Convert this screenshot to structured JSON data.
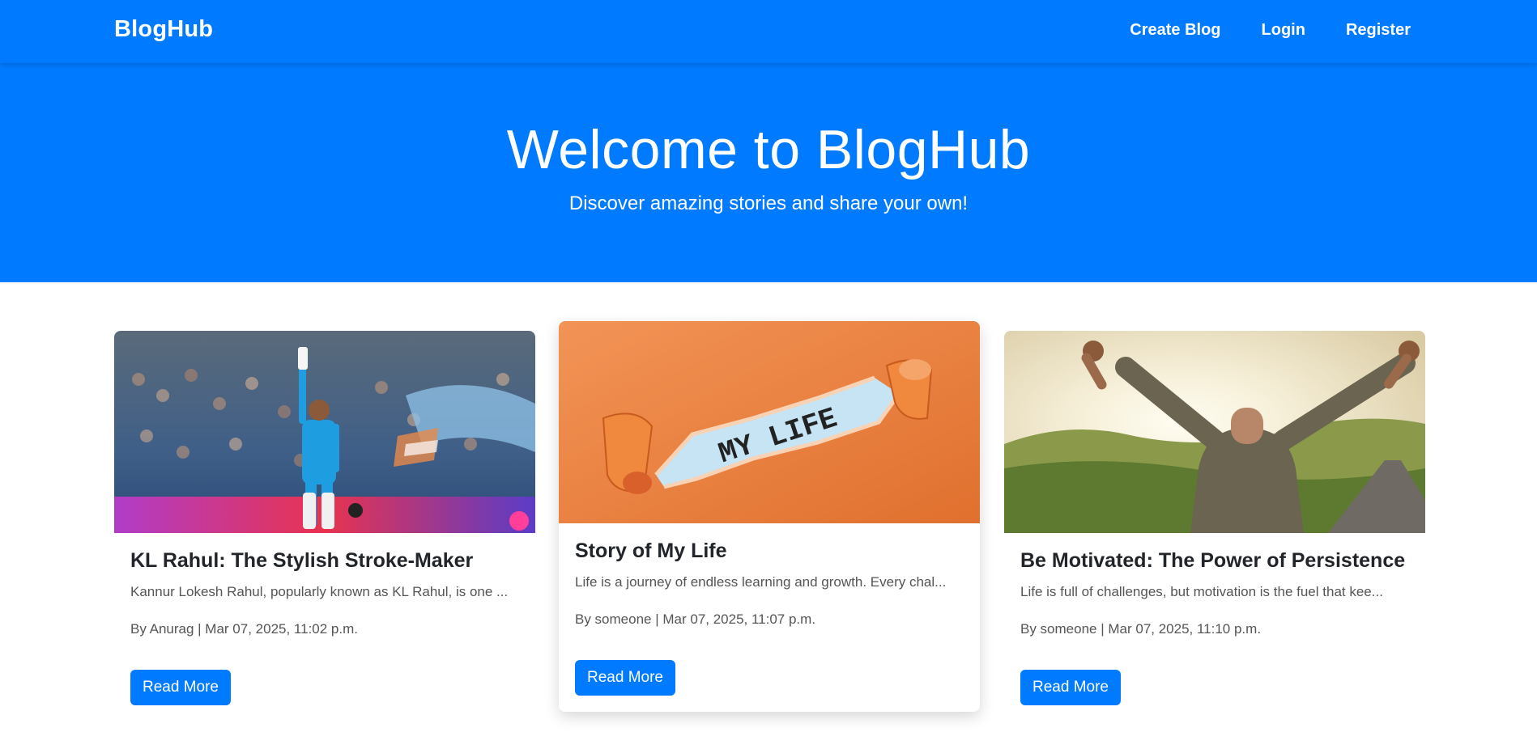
{
  "nav": {
    "brand": "BlogHub",
    "links": [
      "Create Blog",
      "Login",
      "Register"
    ]
  },
  "hero": {
    "title": "Welcome to BlogHub",
    "subtitle": "Discover amazing stories and share your own!"
  },
  "posts": [
    {
      "title": "KL Rahul: The Stylish Stroke-Maker",
      "excerpt": "Kannur Lokesh Rahul, popularly known as KL Rahul, is one ...",
      "meta": "By Anurag | Mar 07, 2025, 11:02 p.m.",
      "button": "Read More"
    },
    {
      "title": "Story of My Life",
      "excerpt": "Life is a journey of endless learning and growth. Every chal...",
      "meta": "By someone | Mar 07, 2025, 11:07 p.m.",
      "button": "Read More",
      "image_text": "MY LIFE"
    },
    {
      "title": "Be Motivated: The Power of Persistence",
      "excerpt": "Life is full of challenges, but motivation is the fuel that kee...",
      "meta": "By someone | Mar 07, 2025, 11:10 p.m.",
      "button": "Read More"
    }
  ],
  "colors": {
    "primary": "#007bff",
    "text": "#212529",
    "muted": "#555555"
  }
}
